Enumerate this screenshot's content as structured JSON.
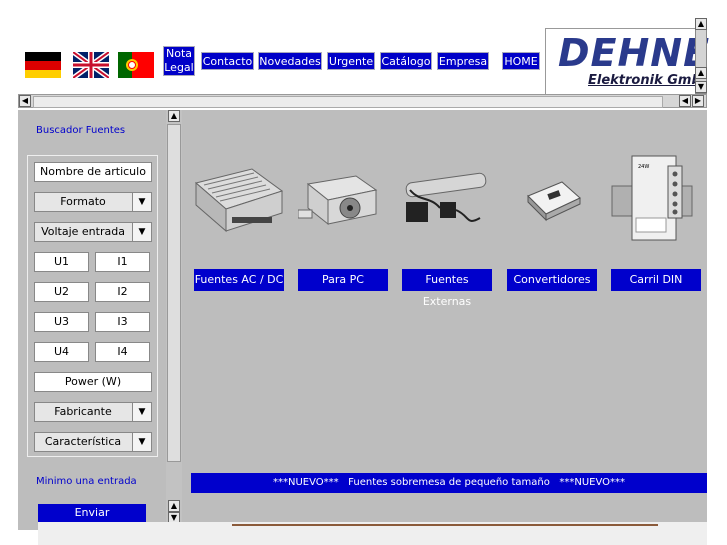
{
  "languages": [
    {
      "name": "german-flag"
    },
    {
      "name": "uk-flag"
    },
    {
      "name": "portugal-flag"
    }
  ],
  "nav": {
    "nota_line1": "Nota",
    "nota_line2": "Legal",
    "items": [
      "Contacto",
      "Novedades",
      "Urgente",
      "Catálogo",
      "Empresa",
      "HOME"
    ]
  },
  "logo": {
    "main": "DEHNE",
    "sub": "Elektronik Gmb"
  },
  "sidebar": {
    "title": "Buscador Fuentes",
    "article_name": "Nombre de articulo",
    "formato": "Formato",
    "voltaje": "Voltaje entrada",
    "u1": "U1",
    "i1": "I1",
    "u2": "U2",
    "i2": "I2",
    "u3": "U3",
    "i3": "I3",
    "u4": "U4",
    "i4": "I4",
    "power": "Power (W)",
    "fabricante": "Fabricante",
    "caracteristica": "Característica",
    "min_entry": "Minimo una entrada",
    "submit": "Enviar"
  },
  "categories": [
    "Fuentes AC / DC",
    "Para PC",
    "Fuentes Externas",
    "Convertidores",
    "Carril DIN"
  ],
  "news_ticker": "***NUEVO***   Fuentes sobremesa de pequeño tamaño   ***NUEVO***",
  "colors": {
    "nav_blue": "#0000c8",
    "panel_gray": "#bdbdbd",
    "logo_blue": "#2a3a8c"
  }
}
